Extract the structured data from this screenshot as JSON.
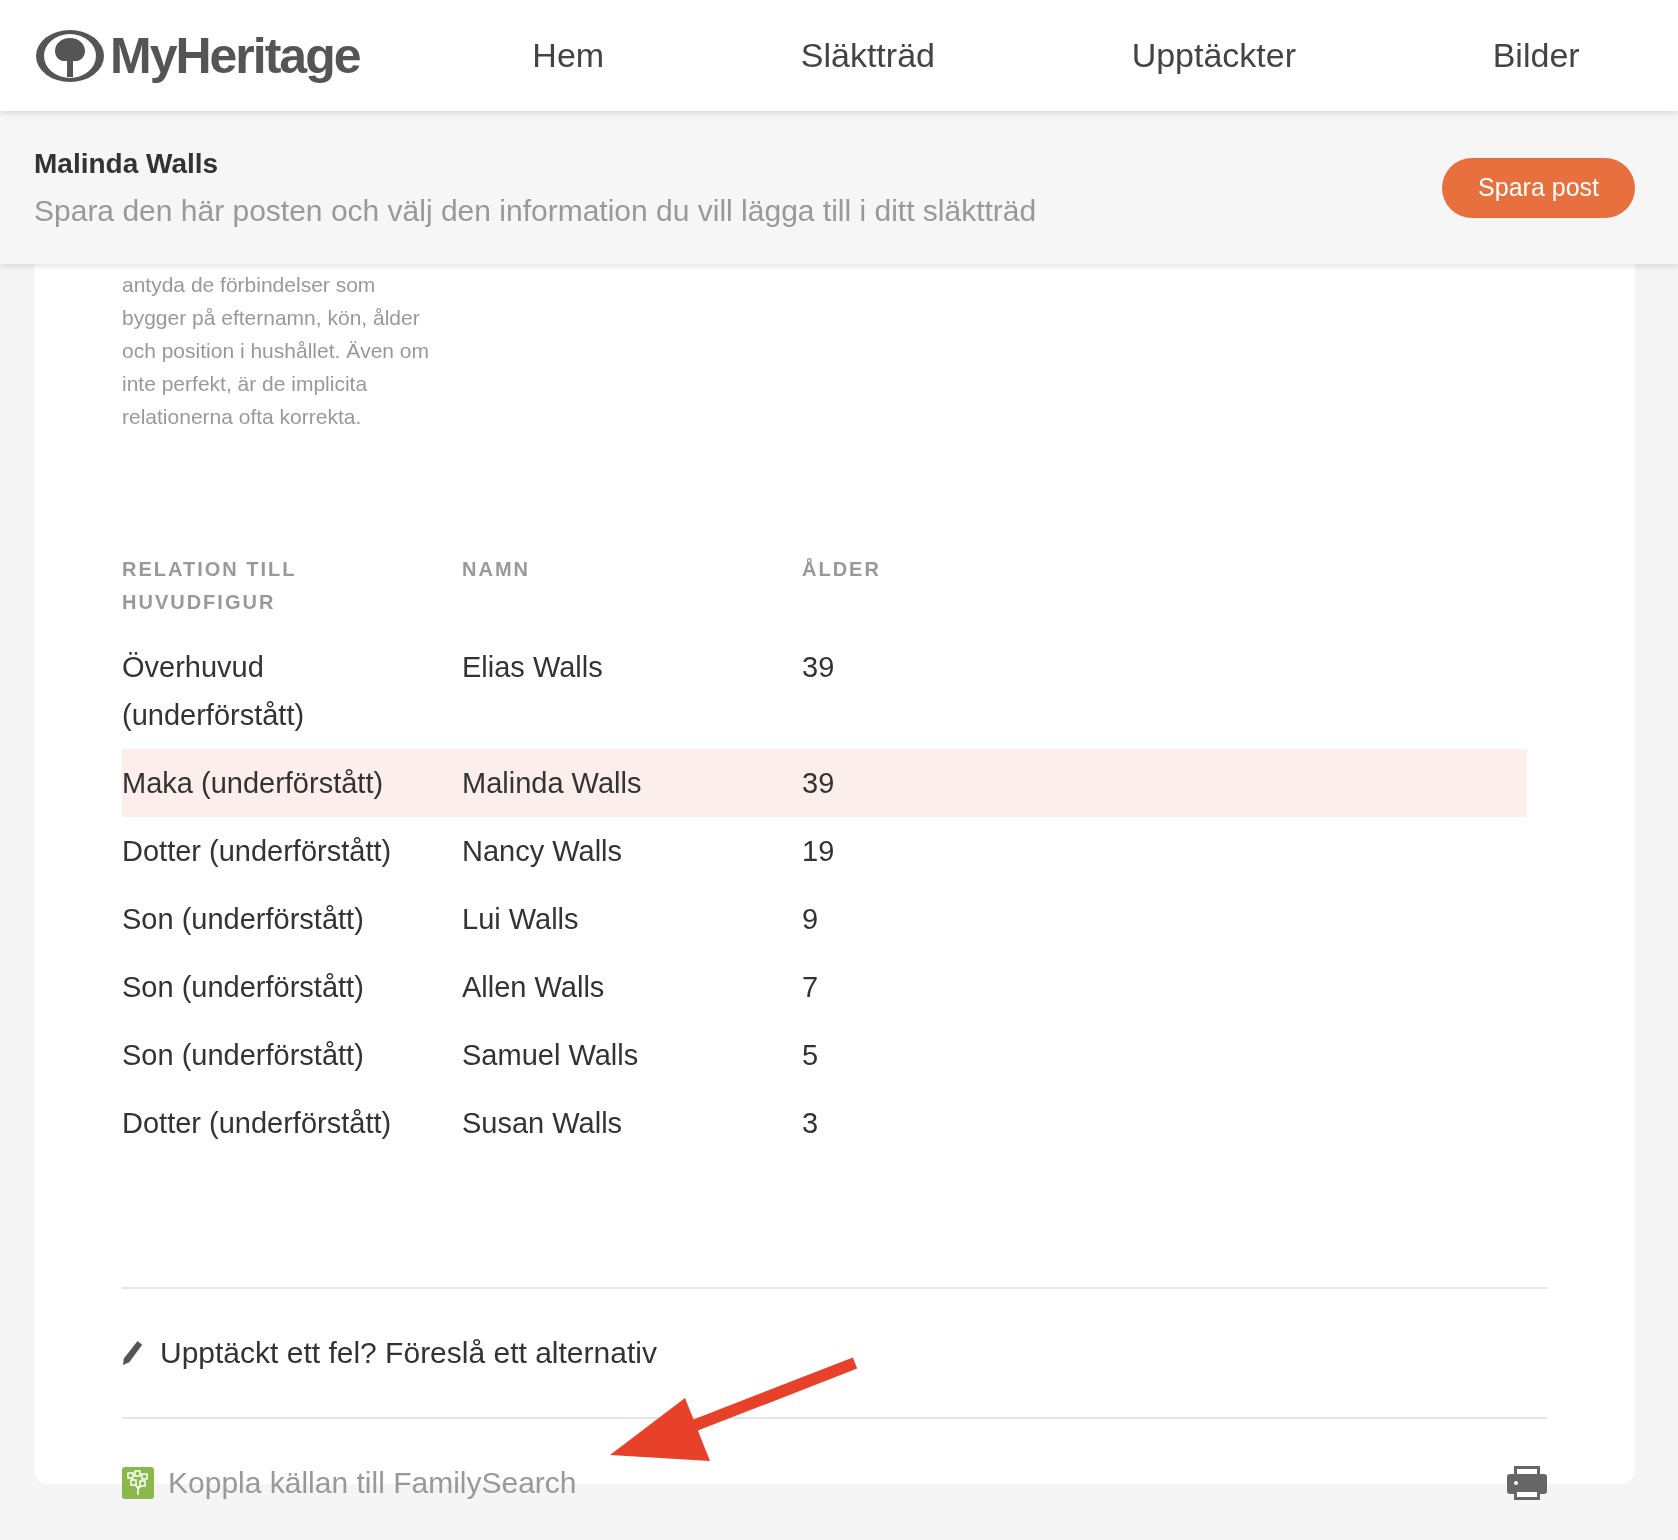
{
  "header": {
    "logo": "MyHeritage",
    "nav": [
      {
        "label": "Hem"
      },
      {
        "label": "Släktträd"
      },
      {
        "label": "Upptäckter"
      },
      {
        "label": "Bilder"
      }
    ]
  },
  "record_bar": {
    "title": "Malinda Walls",
    "subtitle": "Spara den här posten och välj den information du vill lägga till i ditt släktträd",
    "button": "Spara post"
  },
  "note": [
    "antyda de förbindelser som",
    "bygger på efternamn, kön, ålder",
    "och position i hushållet. Även om",
    "inte perfekt, är de implicita",
    "relationerna ofta korrekta."
  ],
  "table": {
    "columns": [
      "RELATION TILL HUVUDFIGUR",
      "NAMN",
      "ÅLDER"
    ],
    "rows": [
      {
        "cells": [
          "Överhuvud (underförstått)",
          "Elias Walls",
          "39"
        ],
        "selected": false
      },
      {
        "cells": [
          "Maka (underförstått)",
          "Malinda Walls",
          "39"
        ],
        "selected": true
      },
      {
        "cells": [
          "Dotter (underförstått)",
          "Nancy Walls",
          "19"
        ],
        "selected": false
      },
      {
        "cells": [
          "Son (underförstått)",
          "Lui Walls",
          "9"
        ],
        "selected": false
      },
      {
        "cells": [
          "Son (underförstått)",
          "Allen Walls",
          "7"
        ],
        "selected": false
      },
      {
        "cells": [
          "Son (underförstått)",
          "Samuel Walls",
          "5"
        ],
        "selected": false
      },
      {
        "cells": [
          "Dotter (underförstått)",
          "Susan Walls",
          "3"
        ],
        "selected": false
      }
    ]
  },
  "suggest_link": "Upptäckt ett fel? Föreslå ett alternativ",
  "familysearch_link": "Koppla källan till FamilySearch"
}
